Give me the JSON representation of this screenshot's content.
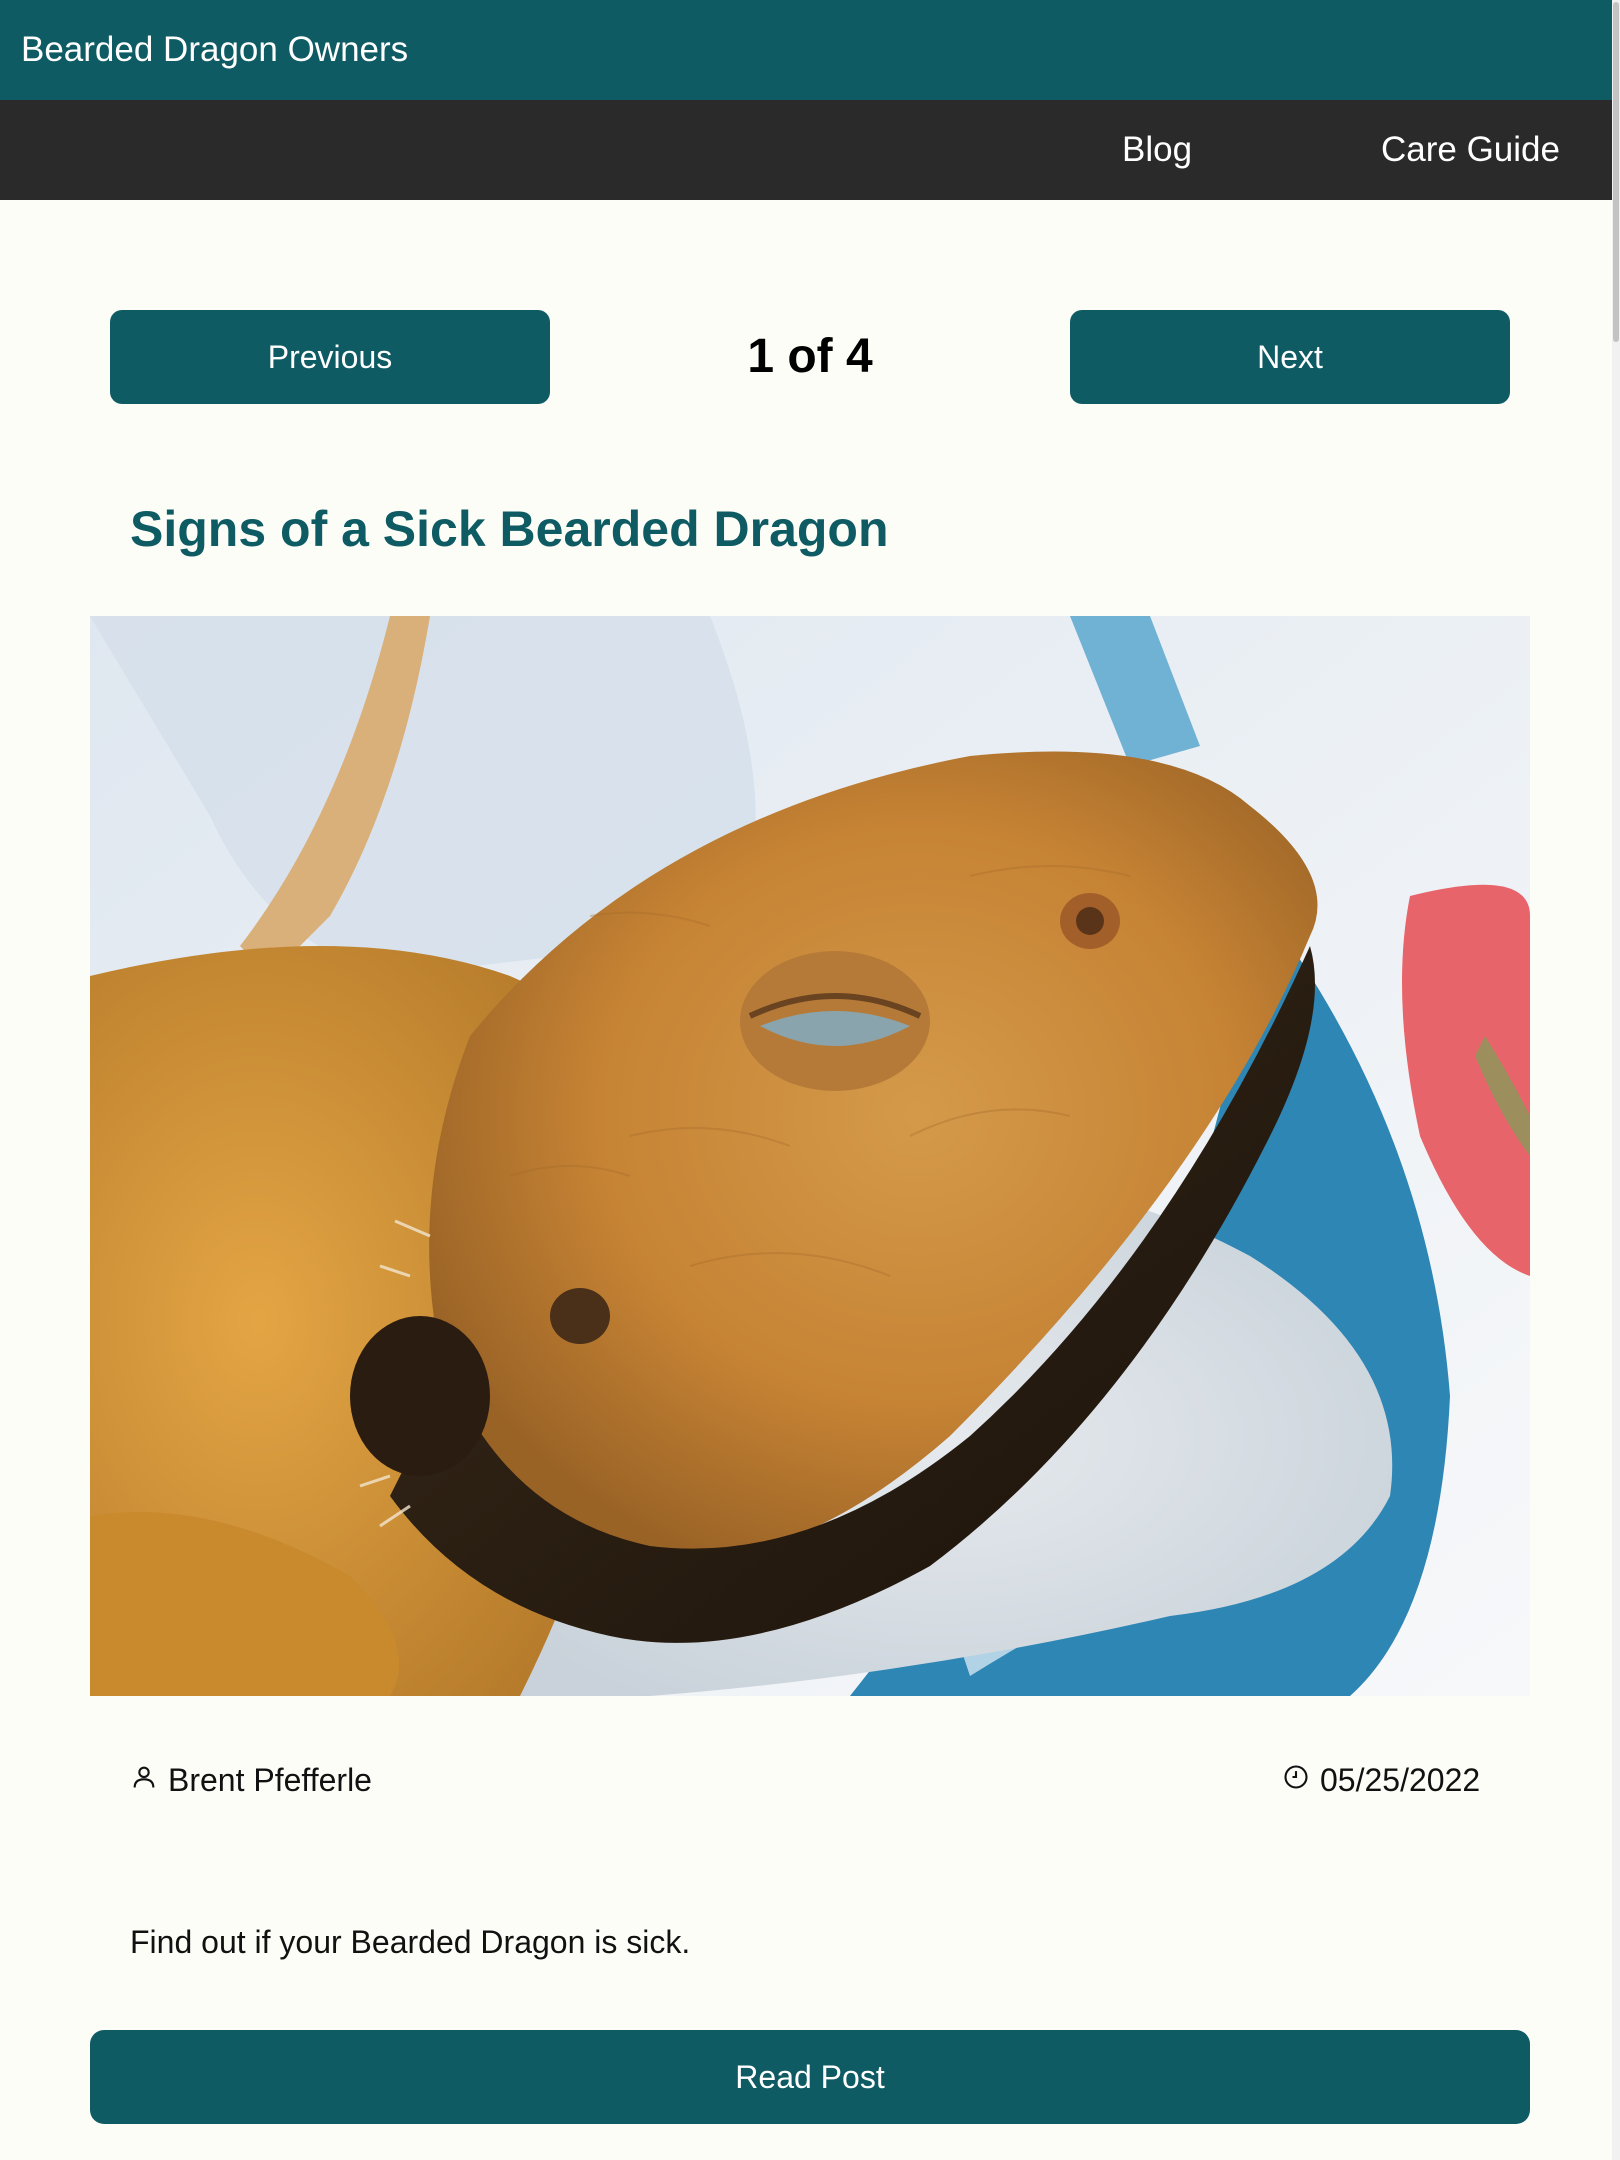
{
  "header": {
    "brand": "Bearded Dragon Owners",
    "bg_color": "#0e5b64"
  },
  "nav": {
    "items": [
      {
        "label": "Blog"
      },
      {
        "label": "Care Guide"
      }
    ],
    "bg_color": "#2a2a2a"
  },
  "pager": {
    "previous_label": "Previous",
    "next_label": "Next",
    "count_text": "1 of 4"
  },
  "post": {
    "title": "Signs of a Sick Bearded Dragon",
    "image_alt": "Close-up of a bearded dragon with eyes half closed resting on a blue and white fleece bed",
    "author": "Brent Pfefferle",
    "author_icon": "user-icon",
    "date": "05/25/2022",
    "date_icon": "clock-icon",
    "excerpt": "Find out if your Bearded Dragon is sick.",
    "read_label": "Read Post"
  },
  "colors": {
    "accent": "#0e5b64",
    "page_bg": "#fdfdf8"
  }
}
